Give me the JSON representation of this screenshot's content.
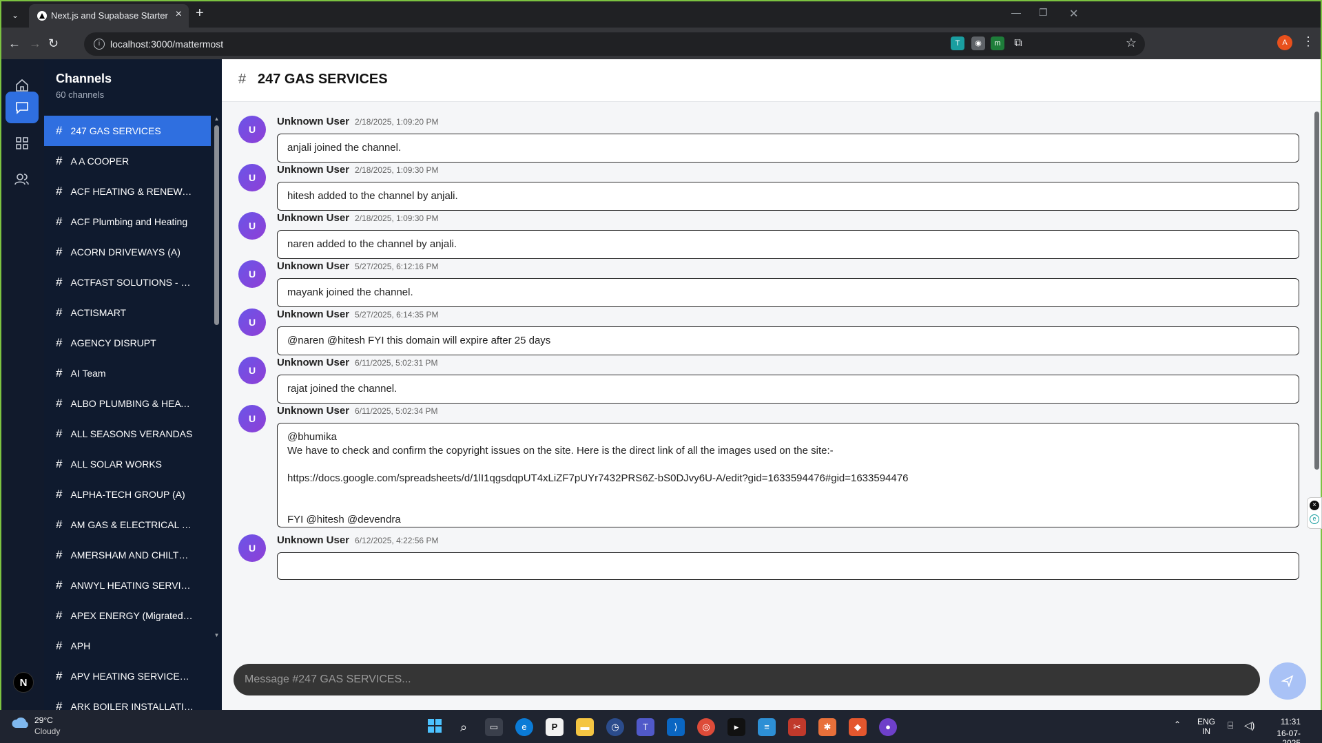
{
  "browser": {
    "tab_title": "Next.js and Supabase Starter Kit",
    "url": "localhost:3000/mattermost"
  },
  "sidebar": {
    "title": "Channels",
    "count": "60 channels",
    "channels": [
      "247 GAS SERVICES",
      "A A COOPER",
      "ACF HEATING & RENEWABLES",
      "ACF Plumbing and Heating",
      "ACORN DRIVEWAYS (A)",
      "ACTFAST SOLUTIONS - MIGRATED",
      "ACTISMART",
      "AGENCY DISRUPT",
      "AI Team",
      "ALBO PLUMBING & HEATING",
      "ALL SEASONS VERANDAS",
      "ALL SOLAR WORKS",
      "ALPHA-TECH GROUP (A)",
      "AM GAS & ELECTRICAL SERVICES",
      "AMERSHAM AND CHILTERN",
      "ANWYL HEATING SERVICES",
      "APEX ENERGY (Migrated Client)",
      "APH",
      "APV HEATING SERVICES - ...",
      "ARK BOILER INSTALLATIONS"
    ]
  },
  "channel": {
    "name": "247 GAS SERVICES"
  },
  "messages": [
    {
      "user": "Unknown User",
      "time": "2/18/2025, 1:09:20 PM",
      "text": "anjali joined the channel."
    },
    {
      "user": "Unknown User",
      "time": "2/18/2025, 1:09:30 PM",
      "text": "hitesh added to the channel by anjali."
    },
    {
      "user": "Unknown User",
      "time": "2/18/2025, 1:09:30 PM",
      "text": "naren added to the channel by anjali."
    },
    {
      "user": "Unknown User",
      "time": "5/27/2025, 6:12:16 PM",
      "text": "mayank joined the channel."
    },
    {
      "user": "Unknown User",
      "time": "5/27/2025, 6:14:35 PM",
      "text": "@naren @hitesh FYI this domain will expire after 25 days"
    },
    {
      "user": "Unknown User",
      "time": "6/11/2025, 5:02:31 PM",
      "text": "rajat joined the channel."
    },
    {
      "user": "Unknown User",
      "time": "6/11/2025, 5:02:34 PM",
      "text": "@bhumika\nWe have to check and confirm the copyright issues on the site. Here is the direct link of all the images used on the site:-\n\nhttps://docs.google.com/spreadsheets/d/1lI1qgsdqpUT4xLiZF7pUYr7432PRS6Z-bS0DJvy6U-A/edit?gid=1633594476#gid=1633594476\n\n\nFYI @hitesh @devendra"
    },
    {
      "user": "Unknown User",
      "time": "6/12/2025, 4:22:56 PM",
      "text": ""
    }
  ],
  "avatar_letter": "U",
  "composer": {
    "placeholder": "Message #247 GAS SERVICES..."
  },
  "taskbar": {
    "temp": "29°C",
    "condition": "Cloudy",
    "lang": "ENG",
    "region": "IN",
    "time": "11:31",
    "date": "16-07-2025"
  },
  "colors": {
    "accent": "#2f6fe0",
    "sidebar_bg": "#0f1a2e",
    "avatar": "#7b4fe0"
  }
}
